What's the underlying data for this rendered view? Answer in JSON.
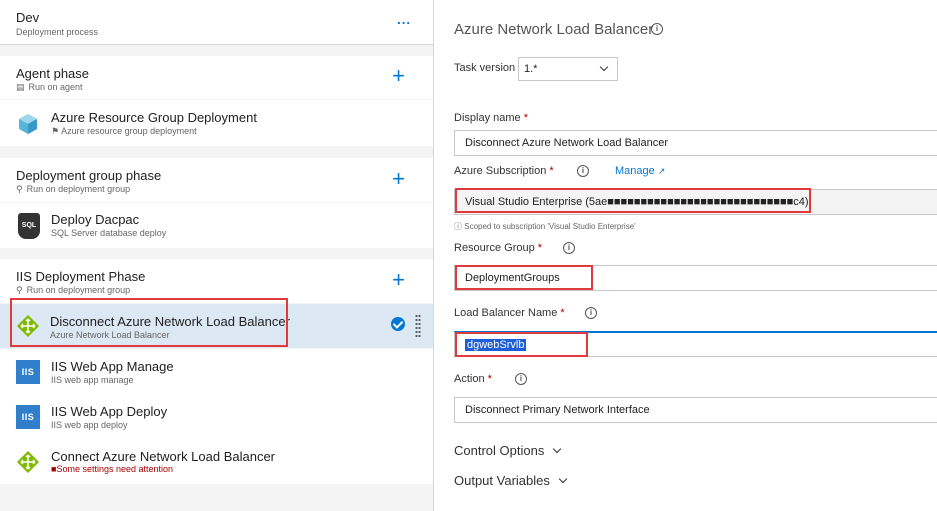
{
  "env": {
    "title": "Dev",
    "subtitle": "Deployment process",
    "more": "..."
  },
  "agent_phase": {
    "title": "Agent phase",
    "subtitle": "Run on agent"
  },
  "tasks": {
    "arg": {
      "title": "Azure Resource Group Deployment",
      "subtitle": "Azure resource group deployment"
    },
    "dacpac": {
      "title": "Deploy Dacpac",
      "subtitle": "SQL Server database deploy",
      "icon_text": "SQL"
    },
    "disconnect": {
      "title": "Disconnect Azure Network Load Balancer",
      "subtitle": "Azure Network Load Balancer"
    },
    "iis_manage": {
      "title": "IIS Web App Manage",
      "subtitle": "IIS web app manage",
      "icon_text": "IIS"
    },
    "iis_deploy": {
      "title": "IIS Web App Deploy",
      "subtitle": "IIS web app deploy",
      "icon_text": "IIS"
    },
    "connect": {
      "title": "Connect Azure Network Load Balancer",
      "subtitle": "Some settings need attention"
    }
  },
  "deployment_group_phase": {
    "title": "Deployment group phase",
    "subtitle": "Run on deployment group"
  },
  "iis_phase": {
    "title": "IIS Deployment Phase",
    "subtitle": "Run on deployment group"
  },
  "plus_symbol": "+",
  "details": {
    "title": "Azure Network Load Balancer",
    "task_version_label": "Task version",
    "task_version_value": "1.*",
    "display_name_label": "Display name",
    "display_name_value": "Disconnect Azure Network Load Balancer",
    "subscription_label": "Azure Subscription",
    "manage_label": "Manage",
    "subscription_value": "Visual Studio Enterprise (5ae■■■■■■■■■■■■■■■■■■■■■■■■■■■■c4)",
    "scope_hint": "Scoped to subscription 'Visual Studio Enterprise'",
    "resource_group_label": "Resource Group",
    "resource_group_value": "DeploymentGroups",
    "lb_name_label": "Load Balancer Name",
    "lb_name_value": "dgwebSrvlb",
    "action_label": "Action",
    "action_value": "Disconnect Primary Network Interface",
    "control_options": "Control Options",
    "output_variables": "Output Variables",
    "required_mark": "*"
  },
  "colors": {
    "accent": "#0078d4",
    "highlight": "#e0393e",
    "selected_row": "#dce8f4",
    "warning": "#a80000"
  }
}
